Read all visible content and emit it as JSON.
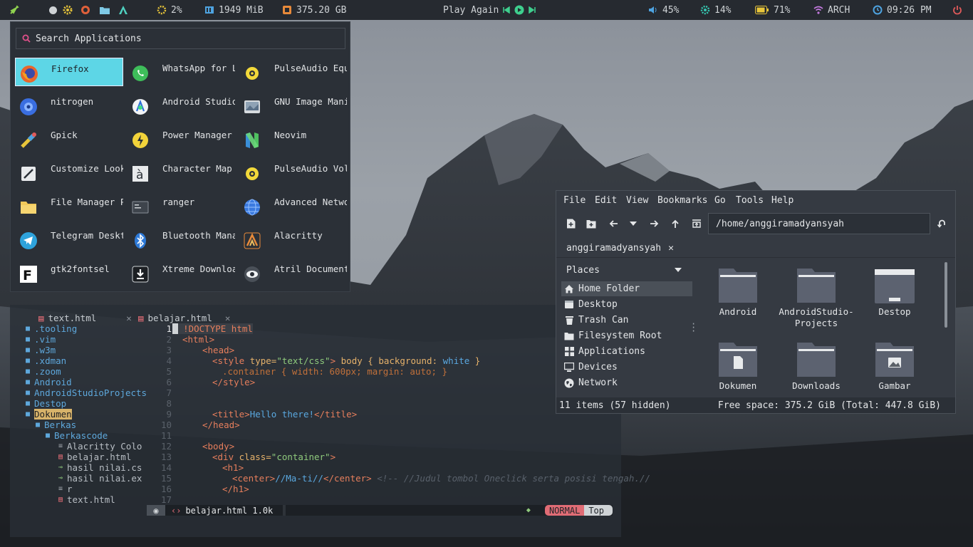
{
  "topbar": {
    "cpu": "2%",
    "ram": "1949 MiB",
    "disk": "375.20 GB",
    "music": "Play Again",
    "volume": "45%",
    "brightness": "14%",
    "battery": "71%",
    "network": "ARCH",
    "clock": "09:26 PM",
    "colors": {
      "bar_bg": "#262a30",
      "cpu": "#e8c53a",
      "ram": "#4ea3e0",
      "disk": "#e88a3a",
      "volume": "#4ea3e0",
      "brightness": "#36c6b0",
      "battery": "#e8c53a",
      "wifi": "#c47ae0",
      "clock": "#4ea3e0",
      "power": "#e05a5a"
    }
  },
  "launcher": {
    "search_placeholder": "Search Applications",
    "apps": [
      {
        "label": "Firefox",
        "icon": "firefox-icon"
      },
      {
        "label": "WhatsApp for Li…",
        "icon": "whatsapp-icon"
      },
      {
        "label": "PulseAudio Equa…",
        "icon": "pulseaudio-icon"
      },
      {
        "label": "nitrogen",
        "icon": "nitrogen-icon"
      },
      {
        "label": "Android Studio",
        "icon": "android-studio-icon"
      },
      {
        "label": "GNU Image Manip…",
        "icon": "gimp-icon"
      },
      {
        "label": "Gpick",
        "icon": "gpick-icon"
      },
      {
        "label": "Power Manager",
        "icon": "power-manager-icon"
      },
      {
        "label": "Neovim",
        "icon": "neovim-icon"
      },
      {
        "label": "Customize Look …",
        "icon": "customize-look-icon"
      },
      {
        "label": "Character Map",
        "icon": "character-map-icon"
      },
      {
        "label": "PulseAudio Volu…",
        "icon": "pulseaudio-volume-icon"
      },
      {
        "label": "File Manager PC…",
        "icon": "file-manager-icon"
      },
      {
        "label": "ranger",
        "icon": "ranger-icon"
      },
      {
        "label": "Advanced Networ…",
        "icon": "network-icon"
      },
      {
        "label": "Telegram Desktop",
        "icon": "telegram-icon"
      },
      {
        "label": "Bluetooth Manag…",
        "icon": "bluetooth-icon"
      },
      {
        "label": "Alacritty",
        "icon": "alacritty-icon"
      },
      {
        "label": "gtk2fontsel",
        "icon": "fontsel-icon"
      },
      {
        "label": "Xtreme Download…",
        "icon": "download-icon"
      },
      {
        "label": "Atril Document …",
        "icon": "atril-icon"
      }
    ]
  },
  "editor": {
    "tabs": [
      {
        "label": "text.html"
      },
      {
        "label": "belajar.html"
      }
    ],
    "tree": [
      {
        "label": ".tooling",
        "type": "dir"
      },
      {
        "label": ".vim",
        "type": "dir"
      },
      {
        "label": ".w3m",
        "type": "dir"
      },
      {
        "label": ".xdman",
        "type": "dir"
      },
      {
        "label": ".zoom",
        "type": "dir"
      },
      {
        "label": "Android",
        "type": "dir"
      },
      {
        "label": "AndroidStudioProjects",
        "type": "dir"
      },
      {
        "label": "Destop",
        "type": "dir"
      },
      {
        "label": "Dokumen",
        "type": "dir-open"
      },
      {
        "label": "Berkas",
        "type": "dir-open"
      },
      {
        "label": "Berkascode",
        "type": "dir-open"
      },
      {
        "label": "Alacritty Colo",
        "type": "file"
      },
      {
        "label": "belajar.html",
        "type": "file"
      },
      {
        "label": "hasil nilai.cs",
        "type": "file"
      },
      {
        "label": "hasil nilai.ex",
        "type": "file"
      },
      {
        "label": "r",
        "type": "file"
      },
      {
        "label": "text.html",
        "type": "file"
      }
    ],
    "line_numbers": [
      "1",
      "2",
      "3",
      "4",
      "5",
      "6",
      "7",
      "8",
      "9",
      "10",
      "11",
      "12",
      "13",
      "14",
      "15",
      "16",
      "17"
    ],
    "code": {
      "l1": "!DOCTYPE html",
      "l2_tag": "<html>",
      "l3_tag": "<head>",
      "l4_open": "<style ",
      "l4_attr": "type=",
      "l4_str": "\"text/css\"",
      "l4_close": ">",
      "l4_rule": " body { background: ",
      "l4_val": "white",
      "l4_end": " }",
      "l5": ".container { width: 600px; margin: auto; }",
      "l6": "</style>",
      "l9_open": "<title>",
      "l9_text": "Hello there!",
      "l9_close": "</title>",
      "l10": "</head>",
      "l12": "<body>",
      "l13_open": "<div ",
      "l13_attr": "class=",
      "l13_str": "\"container\"",
      "l13_close": ">",
      "l14": "<h1>",
      "l15_open": "<center>",
      "l15_text": "//Ma-ti//",
      "l15_close": "</center>",
      "l15_cmt": " <!-- //Judul tombol Oneclick serta posisi tengah.//",
      "l16": "</h1>"
    },
    "status": {
      "file": "belajar.html 1.0k",
      "mode": "NORMAL",
      "pos": "Top"
    }
  },
  "filemanager": {
    "menu": [
      "File",
      "Edit",
      "View",
      "Bookmarks",
      "Go",
      "Tools",
      "Help"
    ],
    "path": "/home/anggiramadyansyah",
    "tab_label": "anggiramadyansyah",
    "places_header": "Places",
    "places": [
      {
        "label": "Home Folder",
        "icon": "home-icon"
      },
      {
        "label": "Desktop",
        "icon": "desktop-icon"
      },
      {
        "label": "Trash Can",
        "icon": "trash-icon"
      },
      {
        "label": "Filesystem Root",
        "icon": "folder-icon"
      },
      {
        "label": "Applications",
        "icon": "apps-icon"
      },
      {
        "label": "Devices",
        "icon": "devices-icon"
      },
      {
        "label": "Network",
        "icon": "network-globe-icon"
      }
    ],
    "items": [
      {
        "label": "Android",
        "icon": "folder-icon"
      },
      {
        "label": "AndroidStudio-Projects",
        "icon": "folder-icon"
      },
      {
        "label": "Destop",
        "icon": "desktop-folder-icon"
      },
      {
        "label": "Dokumen",
        "icon": "documents-folder-icon"
      },
      {
        "label": "Downloads",
        "icon": "folder-icon"
      },
      {
        "label": "Gambar",
        "icon": "pictures-folder-icon"
      }
    ],
    "status_left": "11 items (57 hidden)",
    "status_right": "Free space: 375.2 GiB (Total: 447.8 GiB)"
  }
}
